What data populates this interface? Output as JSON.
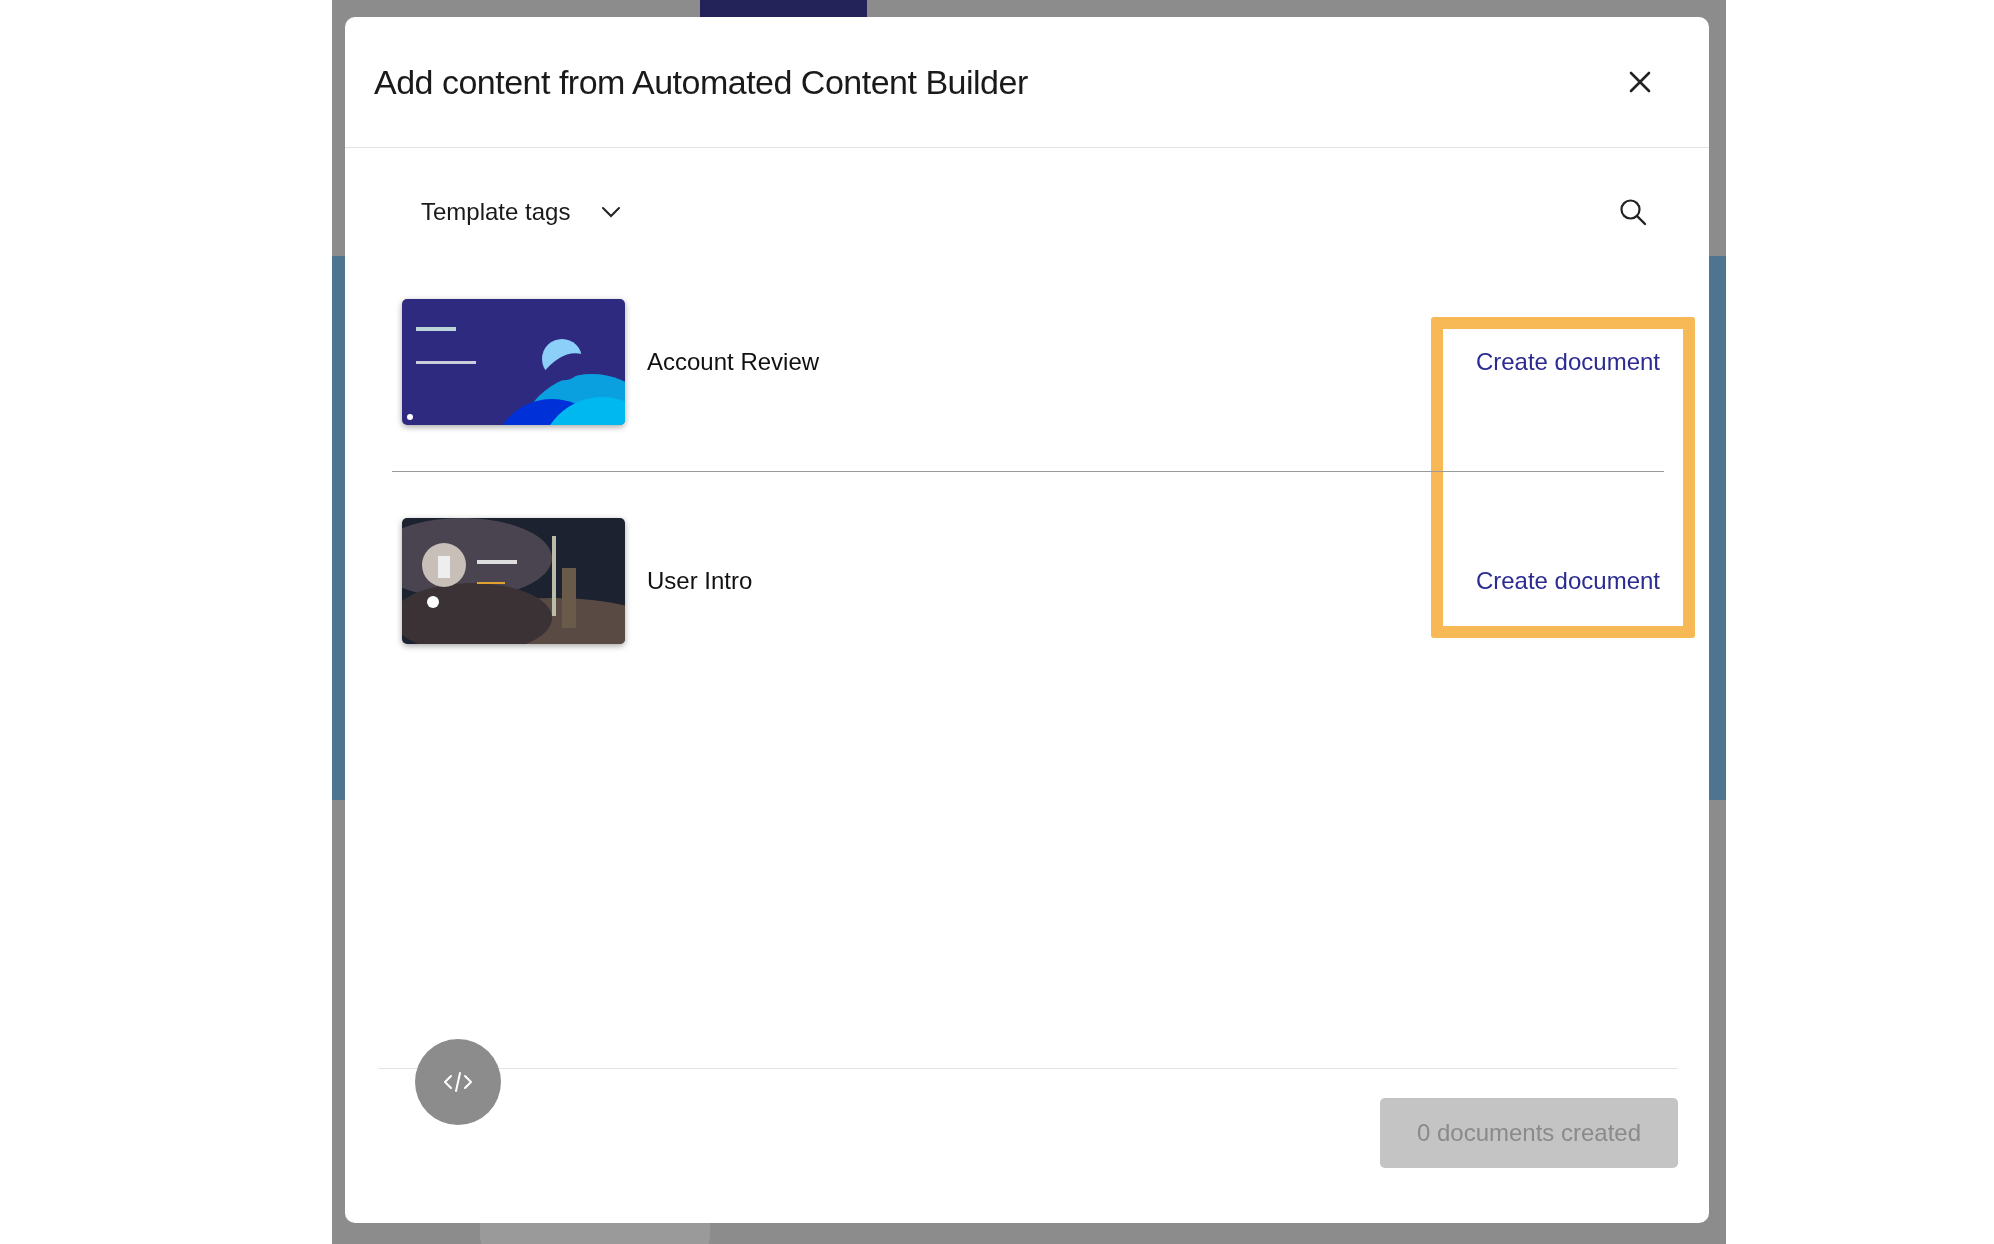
{
  "dialog": {
    "title": "Add content from Automated Content Builder"
  },
  "filter": {
    "label": "Template tags",
    "expanded": false
  },
  "templates": [
    {
      "name": "Account Review",
      "action": "Create document"
    },
    {
      "name": "User Intro",
      "action": "Create document"
    }
  ],
  "actions_highlighted": true,
  "footer": {
    "status_button": {
      "label": "0 documents created",
      "disabled": true
    }
  }
}
